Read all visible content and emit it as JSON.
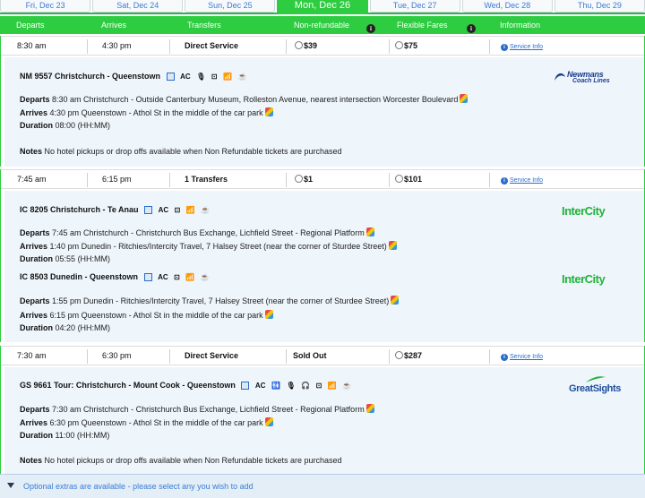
{
  "date_tabs": [
    "Fri, Dec 23",
    "Sat, Dec 24",
    "Sun, Dec 25",
    "Mon, Dec 26",
    "Tue, Dec 27",
    "Wed, Dec 28",
    "Thu, Dec 29"
  ],
  "header": {
    "departs": "Departs",
    "arrives": "Arrives",
    "transfers": "Transfers",
    "non_refundable": "Non-refundable",
    "flexible": "Flexible Fares",
    "information": "Information",
    "info_glyph": "i"
  },
  "common": {
    "service_info": "Service Info",
    "departs_label": "Departs",
    "arrives_label": "Arrives",
    "duration_label": "Duration",
    "notes_label": "Notes",
    "hhmm": "(HH:MM)",
    "ac": "AC"
  },
  "trips": [
    {
      "depart": "8:30 am",
      "arrive": "4:30 pm",
      "transfers": "Direct Service",
      "nonref": "$39",
      "flex": "$75",
      "legs": [
        {
          "title": "NM 9557 Christchurch - Queenstown",
          "logo": "Newmans",
          "logo_sub": "Coach Lines",
          "departs": "8:30 am Christchurch - Outside Canterbury Museum, Rolleston Avenue, nearest intersection Worcester Boulevard",
          "arrives": "4:30 pm Queenstown - Athol St in the middle of the car park",
          "duration": "08:00"
        }
      ],
      "notes": "No hotel pickups or drop offs available when Non Refundable tickets are purchased"
    },
    {
      "depart": "7:45 am",
      "arrive": "6:15 pm",
      "transfers": "1 Transfers",
      "nonref": "$1",
      "flex": "$101",
      "legs": [
        {
          "title": "IC 8205 Christchurch - Te Anau",
          "logo": "InterCity",
          "departs": "7:45 am Christchurch - Christchurch Bus Exchange, Lichfield Street - Regional Platform",
          "arrives": "1:40 pm Dunedin - Ritchies/Intercity Travel, 7 Halsey Street (near the corner of Sturdee Street)",
          "duration": "05:55"
        },
        {
          "title": "IC 8503 Dunedin - Queenstown",
          "logo": "InterCity",
          "departs": "1:55 pm Dunedin - Ritchies/Intercity Travel, 7 Halsey Street (near the corner of Sturdee Street)",
          "arrives": "6:15 pm Queenstown - Athol St in the middle of the car park",
          "duration": "04:20"
        }
      ]
    },
    {
      "depart": "7:30 am",
      "arrive": "6:30 pm",
      "transfers": "Direct Service",
      "nonref": "Sold Out",
      "flex": "$287",
      "legs": [
        {
          "title": "GS 9661 Tour: Christchurch - Mount Cook - Queenstown",
          "logo": "GreatSights",
          "departs": "7:30 am Christchurch - Christchurch Bus Exchange, Lichfield Street - Regional Platform",
          "arrives": "6:30 pm Queenstown - Athol St in the middle of the car park",
          "duration": "11:00"
        }
      ],
      "notes": "No hotel pickups or drop offs available when Non Refundable tickets are purchased"
    }
  ],
  "extras_text": "Optional extras are available - please select any you wish to add",
  "colors": {
    "accent": "#2ecc40",
    "link": "#2a6cc9",
    "detail_bg": "#eef5fb"
  }
}
